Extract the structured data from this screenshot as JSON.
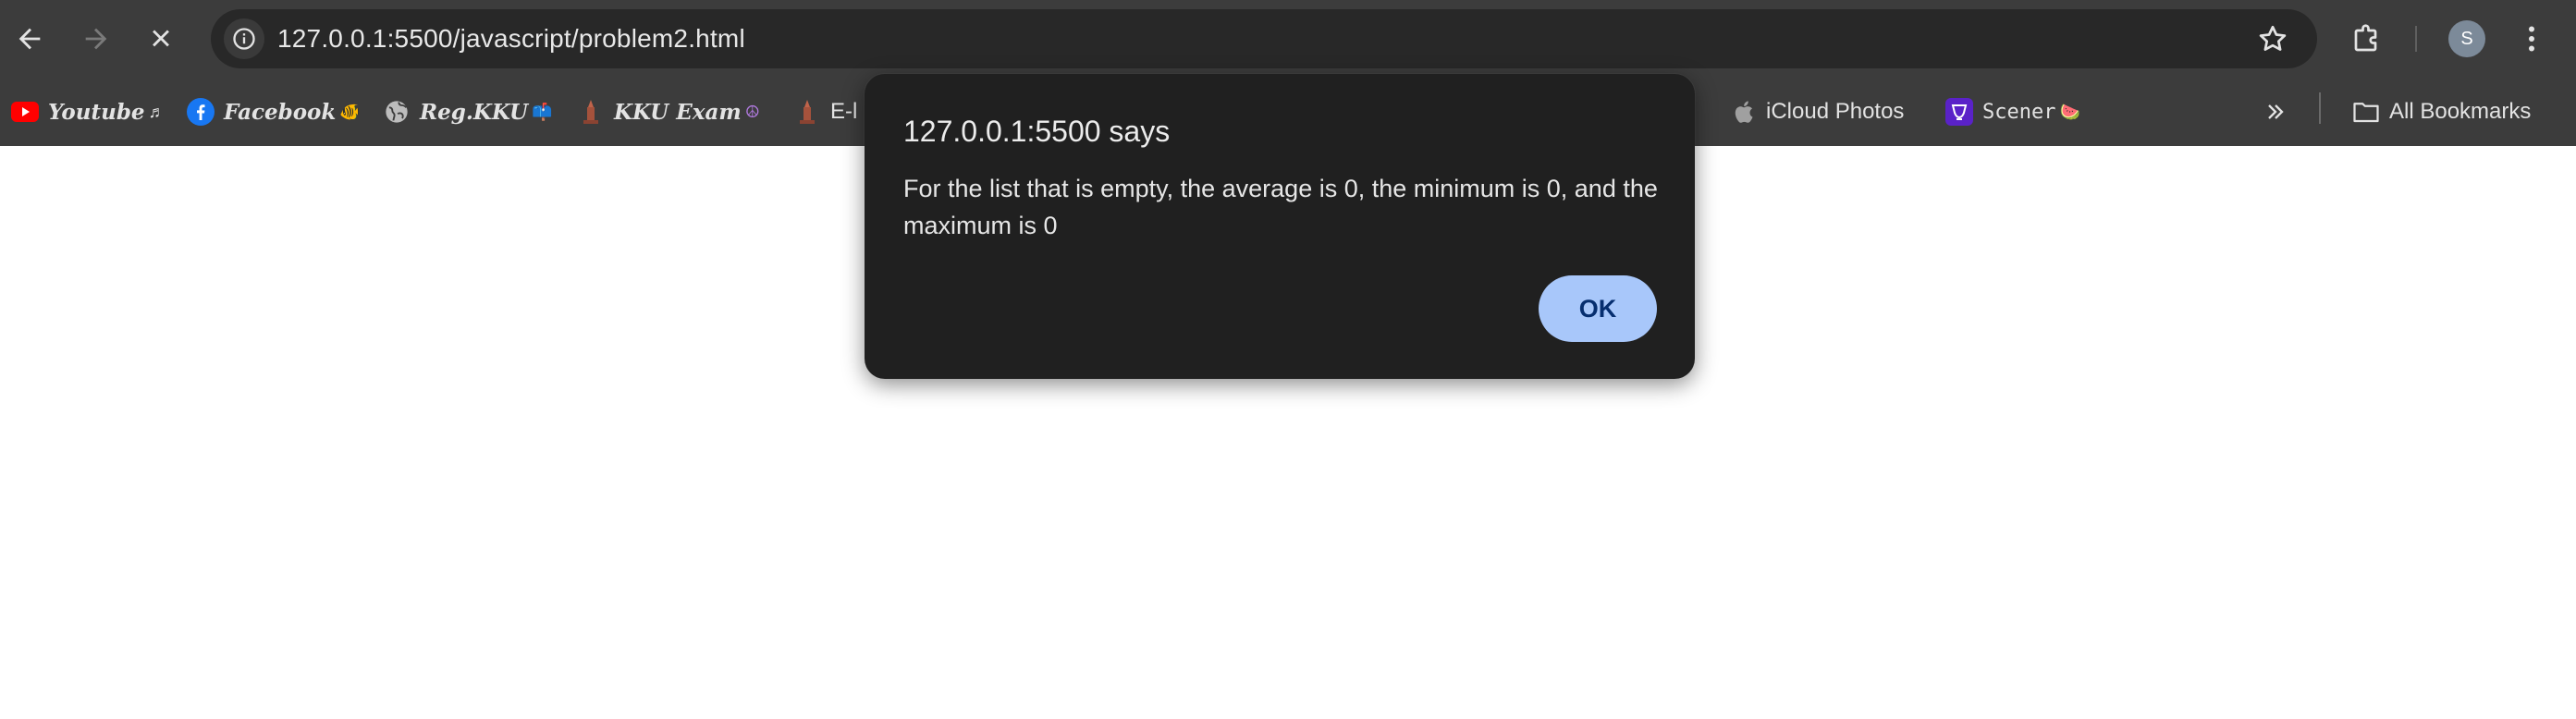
{
  "browser": {
    "url": "127.0.0.1:5500/javascript/problem2.html",
    "profile_initial": "S",
    "icons": {
      "back": "arrow-left-icon",
      "forward": "arrow-right-icon",
      "stop": "close-icon",
      "info": "info-icon",
      "bookmark_star": "star-icon",
      "extensions": "puzzle-icon",
      "menu": "kebab-menu-icon"
    }
  },
  "bookmarks": {
    "items": [
      {
        "label": "Youtube",
        "suffix": "♬",
        "icon": "youtube-icon"
      },
      {
        "label": "Facebook",
        "suffix": "🐠",
        "icon": "facebook-icon"
      },
      {
        "label": "Reg.KKU",
        "suffix": "📫",
        "icon": "globe-icon"
      },
      {
        "label": "KKU Exam",
        "suffix": "☮",
        "icon": "kku-logo-icon"
      },
      {
        "label": "E-l",
        "icon": "kku-logo-icon"
      },
      {
        "label": "iCloud Photos",
        "icon": "apple-icon"
      },
      {
        "label": "Scener",
        "suffix": "🍉",
        "icon": "scener-icon"
      }
    ],
    "overflow_icon": "chevron-double-right-icon",
    "all_bookmarks": "All Bookmarks"
  },
  "dialog": {
    "title": "127.0.0.1:5500 says",
    "message": "For the list that is empty, the average is 0, the minimum is 0, and the maximum is 0",
    "ok_label": "OK"
  },
  "colors": {
    "chrome_bg": "#3c3c3c",
    "omnibox_bg": "#282828",
    "dialog_bg": "#202020",
    "ok_button_bg": "#a8c7fa",
    "ok_button_text": "#062e6f"
  }
}
